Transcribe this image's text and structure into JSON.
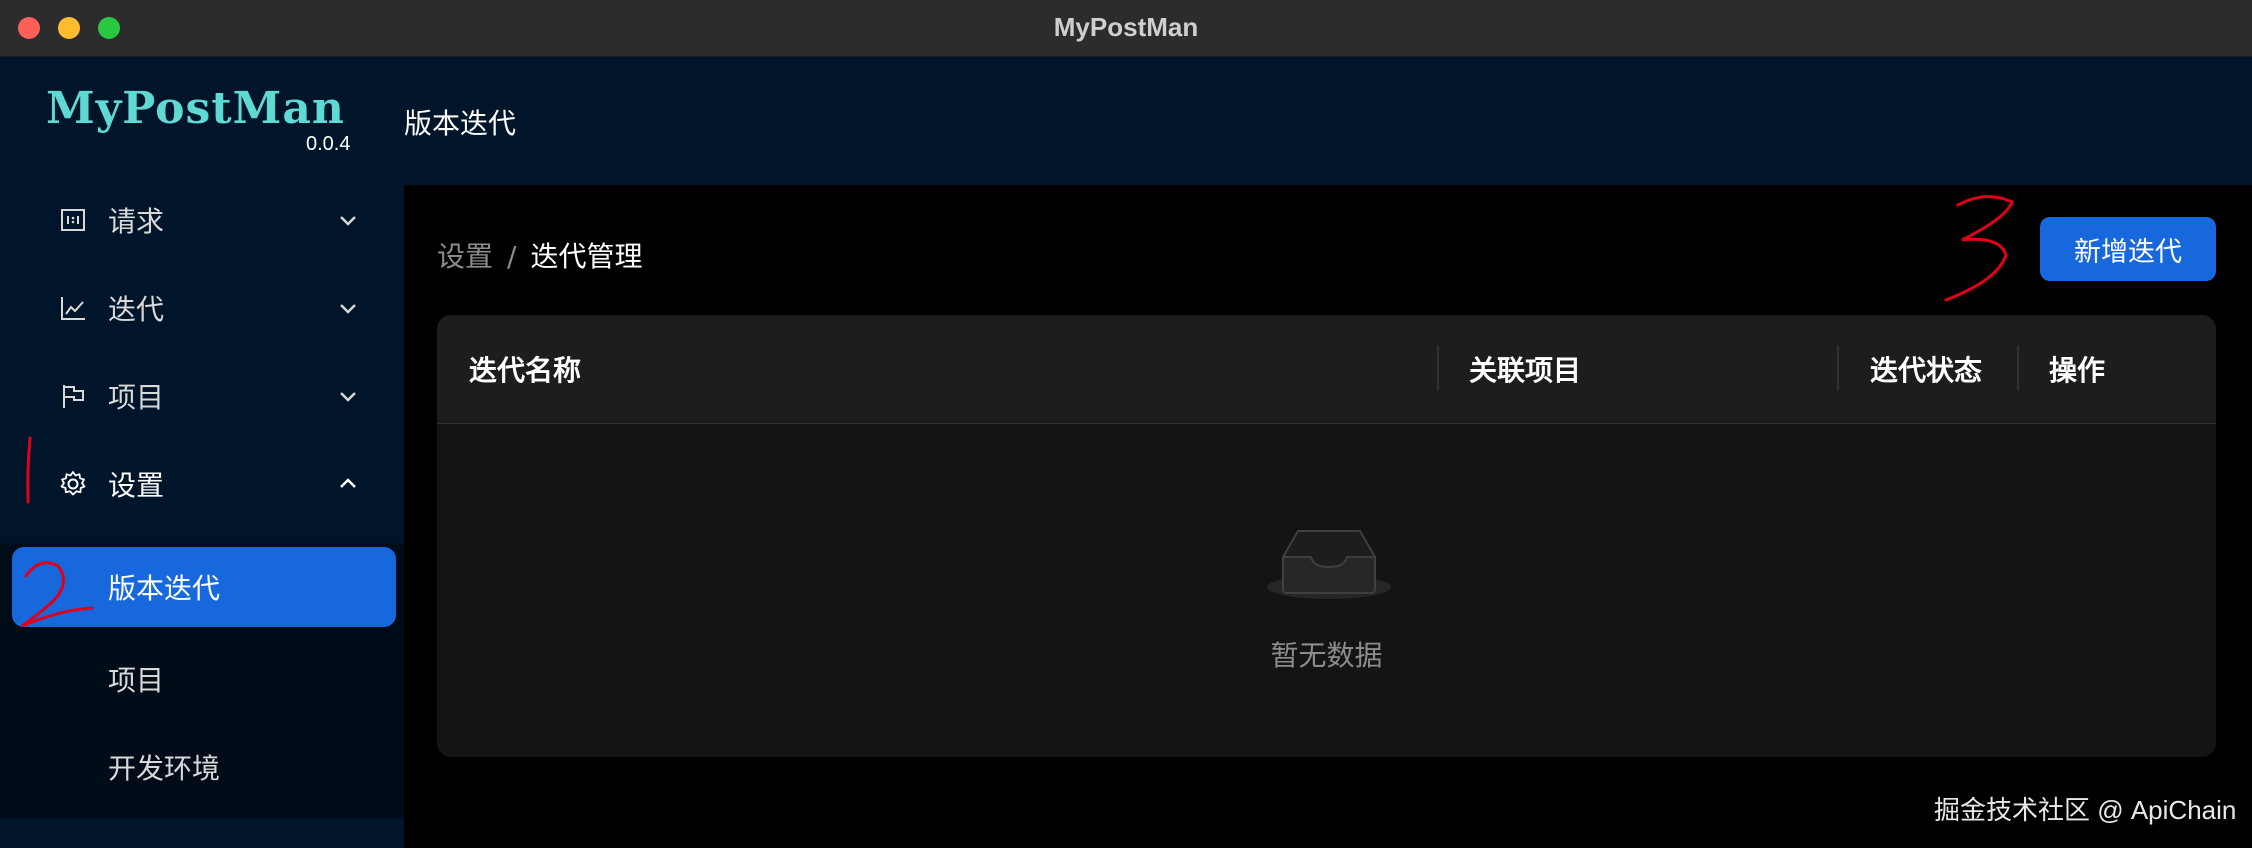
{
  "window": {
    "title": "MyPostMan"
  },
  "sidebar": {
    "logo": "MyPostMan",
    "version": "0.0.4",
    "items": [
      {
        "label": "请求",
        "icon": "request-icon",
        "expanded": false
      },
      {
        "label": "迭代",
        "icon": "line-chart-icon",
        "expanded": false
      },
      {
        "label": "项目",
        "icon": "flag-icon",
        "expanded": false
      },
      {
        "label": "设置",
        "icon": "gear-icon",
        "expanded": true
      }
    ],
    "subitems": [
      {
        "label": "版本迭代",
        "active": true
      },
      {
        "label": "项目",
        "active": false
      },
      {
        "label": "开发环境",
        "active": false
      }
    ]
  },
  "header": {
    "title": "版本迭代"
  },
  "breadcrumb": {
    "parent": "设置",
    "separator": "/",
    "current": "迭代管理"
  },
  "toolbar": {
    "add_label": "新增迭代"
  },
  "table": {
    "columns": [
      "迭代名称",
      "关联项目",
      "迭代状态",
      "操作"
    ],
    "empty_text": "暂无数据"
  },
  "watermark": "掘金技术社区 @ ApiChain",
  "colors": {
    "accent": "#1668dc",
    "sidebar_bg": "#001529",
    "logo": "#5ed9d3",
    "annotation": "#e0001b"
  }
}
